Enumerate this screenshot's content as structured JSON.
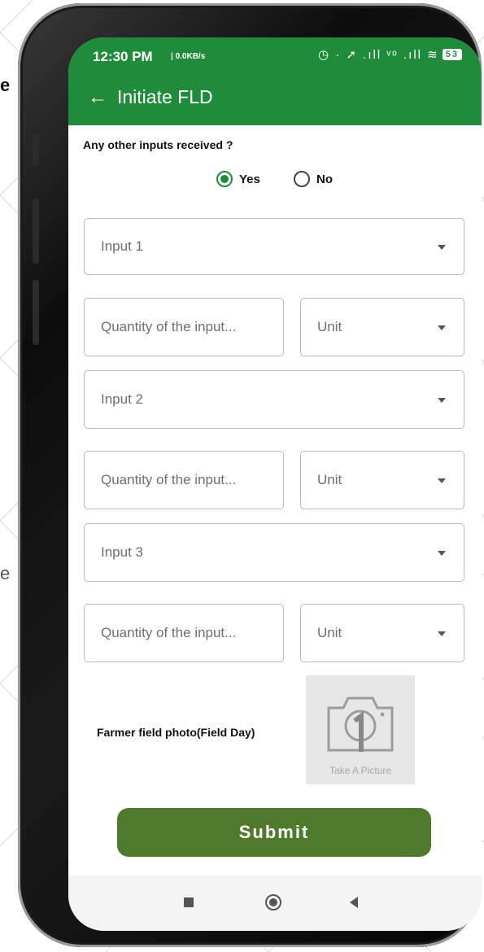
{
  "background": {
    "stray_text_1": "e",
    "stray_text_2": "e"
  },
  "status_bar": {
    "time": "12:30 PM",
    "network_speed": "| 0.0KB/s",
    "icons": "◷  ·   ➚ .ıll ᵛᵒ .ıll ≋",
    "battery": "53"
  },
  "app_bar": {
    "back_icon": "←",
    "title": "Initiate FLD"
  },
  "form": {
    "question": "Any other inputs received ?",
    "options": {
      "yes": "Yes",
      "no": "No",
      "selected": "Yes"
    },
    "inputs": [
      {
        "input_placeholder": "Input 1",
        "quantity_placeholder": "Quantity of the input...",
        "unit_placeholder": "Unit"
      },
      {
        "input_placeholder": "Input 2",
        "quantity_placeholder": "Quantity of the input...",
        "unit_placeholder": "Unit"
      },
      {
        "input_placeholder": "Input 3",
        "quantity_placeholder": "Quantity of the input...",
        "unit_placeholder": "Unit"
      }
    ],
    "photo_label": "Farmer field photo(Field Day)",
    "photo_caption": "Take A Picture",
    "submit_label": "Submit"
  },
  "colors": {
    "accent": "#1e8c3b",
    "submit": "#4f7a2b"
  },
  "icons": [
    "arrow-back-icon",
    "camera-icon",
    "dropdown-caret-icon",
    "nav-recents-icon",
    "nav-home-icon",
    "nav-back-icon"
  ]
}
